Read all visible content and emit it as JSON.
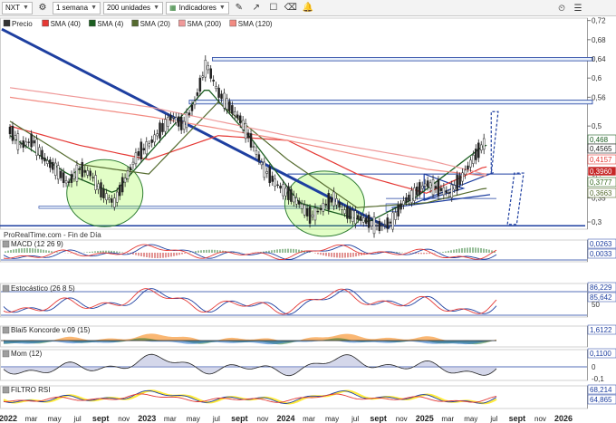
{
  "toolbar": {
    "symbol": "NXT",
    "period": "1 semana",
    "units": "200 unidades",
    "indicators": "Indicadores"
  },
  "legend": {
    "items": [
      {
        "label": "Precio",
        "color": "#333333"
      },
      {
        "label": "SMA (40)",
        "color": "#e53935"
      },
      {
        "label": "SMA (4)",
        "color": "#1b5e20"
      },
      {
        "label": "SMA (20)",
        "color": "#556b2f"
      },
      {
        "label": "SMA (200)",
        "color": "#ef9a9a"
      },
      {
        "label": "SMA (120)",
        "color": "#f28b82"
      }
    ]
  },
  "watermark": "ProRealTime.com - Fin de Día",
  "price_axis": {
    "ticks": [
      "0,72",
      "0,68",
      "0,64",
      "0,6",
      "0,56",
      "0,5",
      "0,45",
      "0,4",
      "0,35",
      "0,3"
    ],
    "tags": [
      {
        "text": "0,468",
        "color": "#1b5e20",
        "bg": "#ffffff"
      },
      {
        "text": "0,4565",
        "color": "#222222",
        "bg": "#ffffff"
      },
      {
        "text": "0,4157",
        "color": "#e53935",
        "bg": "#ffffff"
      },
      {
        "text": "0,3960",
        "color": "#ffffff",
        "bg": "#c62828"
      },
      {
        "text": "0,3777",
        "color": "#33691e",
        "bg": "#ffffff"
      },
      {
        "text": "0,3663",
        "color": "#556b2f",
        "bg": "#ffffff"
      }
    ]
  },
  "time_axis": [
    "2022",
    "mar",
    "may",
    "jul",
    "sept",
    "nov",
    "2023",
    "mar",
    "may",
    "jul",
    "sept",
    "nov",
    "2024",
    "mar",
    "may",
    "jul",
    "sept",
    "nov",
    "2025",
    "mar",
    "may",
    "jul",
    "sept",
    "nov",
    "2026"
  ],
  "panels": [
    {
      "title": "MACD (12 26 9)",
      "values": [
        "0,0263",
        "0,0033"
      ]
    },
    {
      "title": "Estocástico (26 8 5)",
      "values": [
        "86,229",
        "85,642"
      ],
      "ticks": [
        "50"
      ]
    },
    {
      "title": "Blai5 Koncorde v.09 (15)",
      "values": [
        "1,6122"
      ]
    },
    {
      "title": "Mom (12)",
      "values": [
        "0,1100"
      ],
      "ticks": [
        "0",
        "-0,1"
      ]
    },
    {
      "title": "FILTRO RSI",
      "values": [
        "68,214",
        "64,865"
      ]
    }
  ],
  "chart_data": {
    "type": "candlestick",
    "symbol": "NXT",
    "timeframe": "1 semana",
    "x_range": [
      "2022-01",
      "2026-01"
    ],
    "ylim": [
      0.285,
      0.725
    ],
    "grid": false,
    "price_path": [
      [
        "2022-01",
        0.49
      ],
      [
        "2022-02",
        0.46
      ],
      [
        "2022-03",
        0.47
      ],
      [
        "2022-04",
        0.43
      ],
      [
        "2022-05",
        0.41
      ],
      [
        "2022-06",
        0.38
      ],
      [
        "2022-07",
        0.41
      ],
      [
        "2022-08",
        0.4
      ],
      [
        "2022-09",
        0.36
      ],
      [
        "2022-10",
        0.34
      ],
      [
        "2022-11",
        0.39
      ],
      [
        "2022-12",
        0.44
      ],
      [
        "2023-01",
        0.46
      ],
      [
        "2023-02",
        0.49
      ],
      [
        "2023-03",
        0.52
      ],
      [
        "2023-04",
        0.5
      ],
      [
        "2023-05",
        0.55
      ],
      [
        "2023-06",
        0.63
      ],
      [
        "2023-07",
        0.57
      ],
      [
        "2023-08",
        0.54
      ],
      [
        "2023-09",
        0.51
      ],
      [
        "2023-10",
        0.46
      ],
      [
        "2023-11",
        0.41
      ],
      [
        "2023-12",
        0.38
      ],
      [
        "2024-01",
        0.36
      ],
      [
        "2024-02",
        0.34
      ],
      [
        "2024-03",
        0.31
      ],
      [
        "2024-04",
        0.33
      ],
      [
        "2024-05",
        0.35
      ],
      [
        "2024-06",
        0.32
      ],
      [
        "2024-07",
        0.31
      ],
      [
        "2024-08",
        0.3
      ],
      [
        "2024-09",
        0.29
      ],
      [
        "2024-10",
        0.3
      ],
      [
        "2024-11",
        0.34
      ],
      [
        "2024-12",
        0.36
      ],
      [
        "2025-01",
        0.38
      ],
      [
        "2025-02",
        0.37
      ],
      [
        "2025-03",
        0.36
      ],
      [
        "2025-04",
        0.39
      ],
      [
        "2025-05",
        0.43
      ],
      [
        "2025-06",
        0.465
      ]
    ],
    "series": [
      {
        "name": "SMA (40)",
        "color": "#e53935",
        "points": [
          [
            "2022-01",
            0.5
          ],
          [
            "2022-07",
            0.46
          ],
          [
            "2023-01",
            0.43
          ],
          [
            "2023-07",
            0.48
          ],
          [
            "2024-01",
            0.47
          ],
          [
            "2024-07",
            0.4
          ],
          [
            "2025-01",
            0.36
          ],
          [
            "2025-06",
            0.415
          ]
        ]
      },
      {
        "name": "SMA (4)",
        "color": "#1b5e20",
        "points": [
          [
            "2022-01",
            0.48
          ],
          [
            "2022-06",
            0.4
          ],
          [
            "2022-10",
            0.36
          ],
          [
            "2023-02",
            0.47
          ],
          [
            "2023-06",
            0.58
          ],
          [
            "2023-10",
            0.47
          ],
          [
            "2024-02",
            0.34
          ],
          [
            "2024-08",
            0.3
          ],
          [
            "2024-12",
            0.35
          ],
          [
            "2025-06",
            0.46
          ]
        ]
      },
      {
        "name": "SMA (20)",
        "color": "#556b2f",
        "points": [
          [
            "2022-01",
            0.51
          ],
          [
            "2022-07",
            0.42
          ],
          [
            "2023-01",
            0.4
          ],
          [
            "2023-07",
            0.55
          ],
          [
            "2024-01",
            0.43
          ],
          [
            "2024-07",
            0.33
          ],
          [
            "2025-01",
            0.34
          ],
          [
            "2025-06",
            0.37
          ]
        ]
      },
      {
        "name": "SMA (200)",
        "color": "#ef9a9a",
        "points": [
          [
            "2022-01",
            0.58
          ],
          [
            "2023-01",
            0.54
          ],
          [
            "2024-01",
            0.48
          ],
          [
            "2025-01",
            0.43
          ],
          [
            "2025-06",
            0.4
          ]
        ]
      },
      {
        "name": "SMA (120)",
        "color": "#f28b82",
        "points": [
          [
            "2022-01",
            0.56
          ],
          [
            "2023-01",
            0.52
          ],
          [
            "2024-01",
            0.47
          ],
          [
            "2025-01",
            0.41
          ],
          [
            "2025-06",
            0.396
          ]
        ]
      }
    ]
  }
}
